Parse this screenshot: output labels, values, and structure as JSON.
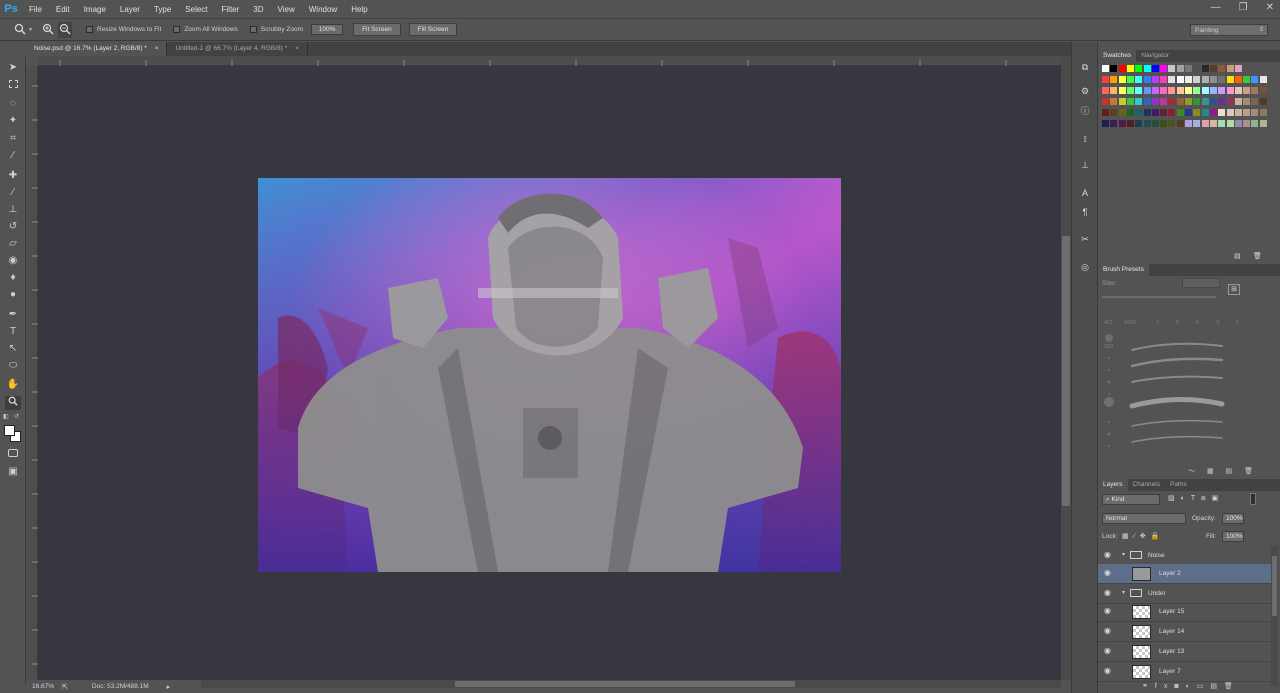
{
  "app": {
    "logo": "Ps"
  },
  "menu": [
    "File",
    "Edit",
    "Image",
    "Layer",
    "Type",
    "Select",
    "Filter",
    "3D",
    "View",
    "Window",
    "Help"
  ],
  "window_controls": {
    "minimize": "—",
    "restore": "❐",
    "close": "✕"
  },
  "options": {
    "resize_windows": "Resize Windows to Fit",
    "zoom_all": "Zoom All Windows",
    "scrubby_zoom": "Scrubby Zoom",
    "zoom_value": "100%",
    "fit_screen": "Fit Screen",
    "fill_screen": "Fill Screen",
    "workspace": "Painting"
  },
  "tabs": [
    {
      "label": "Noise.psd @ 16.7% (Layer 2, RGB/8) *",
      "close": "×"
    },
    {
      "label": "Untitled-1 @ 66.7% (Layer 4, RGB/8) *",
      "close": "×"
    }
  ],
  "status": {
    "zoom": "16.67%",
    "doc": "Doc: 53.2M/488.1M"
  },
  "swatches_panel": {
    "tabs": [
      "Swatches",
      "Navigator"
    ]
  },
  "brush_panel": {
    "title": "Brush Presets",
    "size_label": "Size:",
    "sizes": [
      "421",
      "1860",
      "7",
      "5",
      "6",
      "3",
      "1"
    ],
    "list_sizes": [
      "300",
      "7",
      "5",
      "4",
      "7",
      "33",
      "0",
      "9",
      "4",
      "5"
    ]
  },
  "layers_panel": {
    "tabs": [
      "Layers",
      "Channels",
      "Paths"
    ],
    "kind": "Kind",
    "blend": "Normal",
    "opacity_label": "Opacity:",
    "opacity": "100%",
    "lock_label": "Lock:",
    "fill_label": "Fill:",
    "fill": "100%",
    "layers": [
      {
        "name": "Noise",
        "type": "group"
      },
      {
        "name": "Layer 2",
        "type": "layer",
        "selected": true
      },
      {
        "name": "Under",
        "type": "group"
      },
      {
        "name": "Layer 15",
        "type": "layer"
      },
      {
        "name": "Layer 14",
        "type": "layer"
      },
      {
        "name": "Layer 13",
        "type": "layer"
      },
      {
        "name": "Layer 7",
        "type": "layer"
      }
    ]
  },
  "colors": {
    "accent": "#31a8ff",
    "selection": "#5c6e8a",
    "canvas_bg": "#373740"
  }
}
